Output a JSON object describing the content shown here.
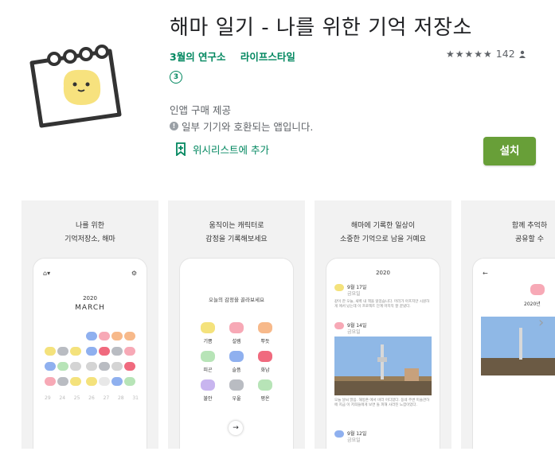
{
  "app": {
    "title": "해마 일기 - 나를 위한 기억 저장소",
    "developer": "3월의 연구소",
    "category": "라이프스타일",
    "rating_count": "142",
    "stars": "★★★★★",
    "rating_value": 4.5,
    "content_rating": "③",
    "in_app": "인앱 구매 제공",
    "compat_icon": "!",
    "compat": "일부 기기와 호환되는 앱입니다.",
    "wishlist": "위시리스트에 추가",
    "install": "설치"
  },
  "screenshots": [
    {
      "caption": [
        "나를 위한",
        "기억저장소, 해마"
      ],
      "year": "2020",
      "month": "MARCH",
      "day_row": [
        "29",
        "24",
        "25",
        "26",
        "27",
        "28",
        "31"
      ]
    },
    {
      "caption": [
        "움직이는 캐릭터로",
        "감정을 기록해보세요"
      ],
      "prompt": "오늘의 감정을 골라보세요",
      "moods": [
        "기쁨",
        "설렘",
        "뿌듯",
        "피곤",
        "슬픔",
        "화남",
        "불안",
        "우울",
        "평온"
      ],
      "next_icon": "→"
    },
    {
      "caption": [
        "해마에 기록한 일상이",
        "소중한 기억으로 남을 거예요"
      ],
      "year": "2020",
      "entries": [
        "9월 17일",
        "9월 14일",
        "9월 12일"
      ],
      "entry_sub": "금요일",
      "text1": "같이 한 오늘, 새벽 내 책을 읽었습니다. 머리가 아프지만 시원하게 에서 났는데 이 프로젝트 단계 마지막 잘 끝냈다.",
      "text2": "오늘 날씨 맑음. 해방촌 에서 바라 어디었다. 동네 주변 미술관하에 지금 이 저희들에게 보면 돌 피해 사라진 느낌이었다."
    },
    {
      "caption": [
        "함께 추억하",
        "공유할 수"
      ],
      "year": "2020년"
    }
  ],
  "icons": {
    "wishlist_icon": "bookmark-plus-icon",
    "next_icon": "chevron-right-icon"
  },
  "colors": {
    "accent": "#01875f",
    "install_bg": "#689f38"
  }
}
